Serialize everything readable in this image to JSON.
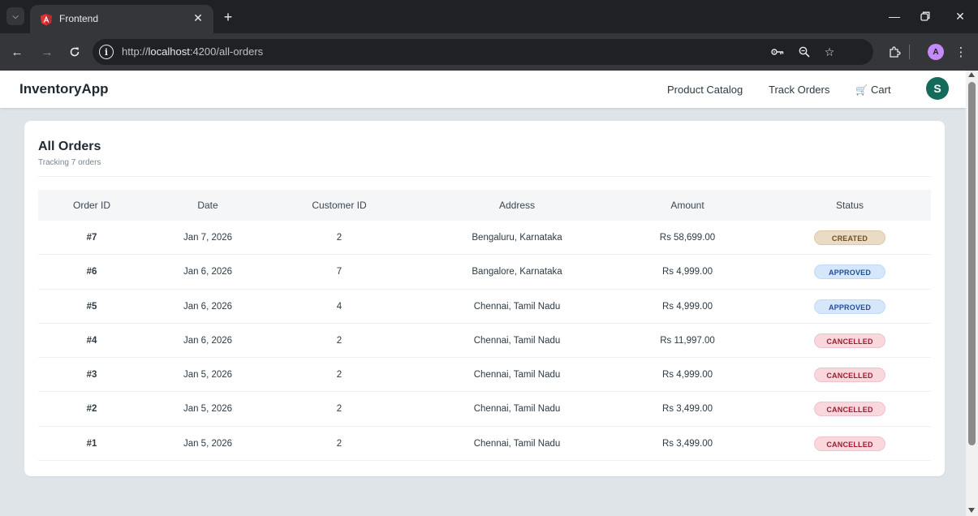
{
  "browser": {
    "tab_title": "Frontend",
    "url_prefix": "http://",
    "url_host": "localhost",
    "url_rest": ":4200/all-orders",
    "profile_initial": "A"
  },
  "navbar": {
    "brand": "InventoryApp",
    "links": [
      "Product Catalog",
      "Track Orders",
      "Cart"
    ],
    "avatar_initial": "S"
  },
  "orders": {
    "title": "All Orders",
    "subtitle": "Tracking 7 orders",
    "columns": [
      "Order ID",
      "Date",
      "Customer ID",
      "Address",
      "Amount",
      "Status"
    ],
    "rows": [
      {
        "id": "#7",
        "date": "Jan 7, 2026",
        "customer": "2",
        "address": "Bengaluru, Karnataka",
        "amount": "Rs 58,699.00",
        "status": "CREATED",
        "status_type": "created"
      },
      {
        "id": "#6",
        "date": "Jan 6, 2026",
        "customer": "7",
        "address": "Bangalore, Karnataka",
        "amount": "Rs 4,999.00",
        "status": "APPROVED",
        "status_type": "approved"
      },
      {
        "id": "#5",
        "date": "Jan 6, 2026",
        "customer": "4",
        "address": "Chennai, Tamil Nadu",
        "amount": "Rs 4,999.00",
        "status": "APPROVED",
        "status_type": "approved"
      },
      {
        "id": "#4",
        "date": "Jan 6, 2026",
        "customer": "2",
        "address": "Chennai, Tamil Nadu",
        "amount": "Rs 11,997.00",
        "status": "CANCELLED",
        "status_type": "cancelled"
      },
      {
        "id": "#3",
        "date": "Jan 5, 2026",
        "customer": "2",
        "address": "Chennai, Tamil Nadu",
        "amount": "Rs 4,999.00",
        "status": "CANCELLED",
        "status_type": "cancelled"
      },
      {
        "id": "#2",
        "date": "Jan 5, 2026",
        "customer": "2",
        "address": "Chennai, Tamil Nadu",
        "amount": "Rs 3,499.00",
        "status": "CANCELLED",
        "status_type": "cancelled"
      },
      {
        "id": "#1",
        "date": "Jan 5, 2026",
        "customer": "2",
        "address": "Chennai, Tamil Nadu",
        "amount": "Rs 3,499.00",
        "status": "CANCELLED",
        "status_type": "cancelled"
      }
    ]
  },
  "icons": {
    "tab_search": "chevron-down-icon",
    "favicon": "angular-logo-icon",
    "password": "key-icon",
    "zoom": "zoom-icon",
    "bookmark": "star-icon",
    "extensions": "puzzle-icon",
    "menu": "kebab-menu-icon",
    "cart": "cart-icon"
  },
  "colors": {
    "brand_avatar": "#146b5b",
    "page_background": "#dfe4e8",
    "created_badge": "#eadcc4",
    "approved_badge": "#d6e6fb",
    "cancelled_badge": "#f8d7dd"
  }
}
